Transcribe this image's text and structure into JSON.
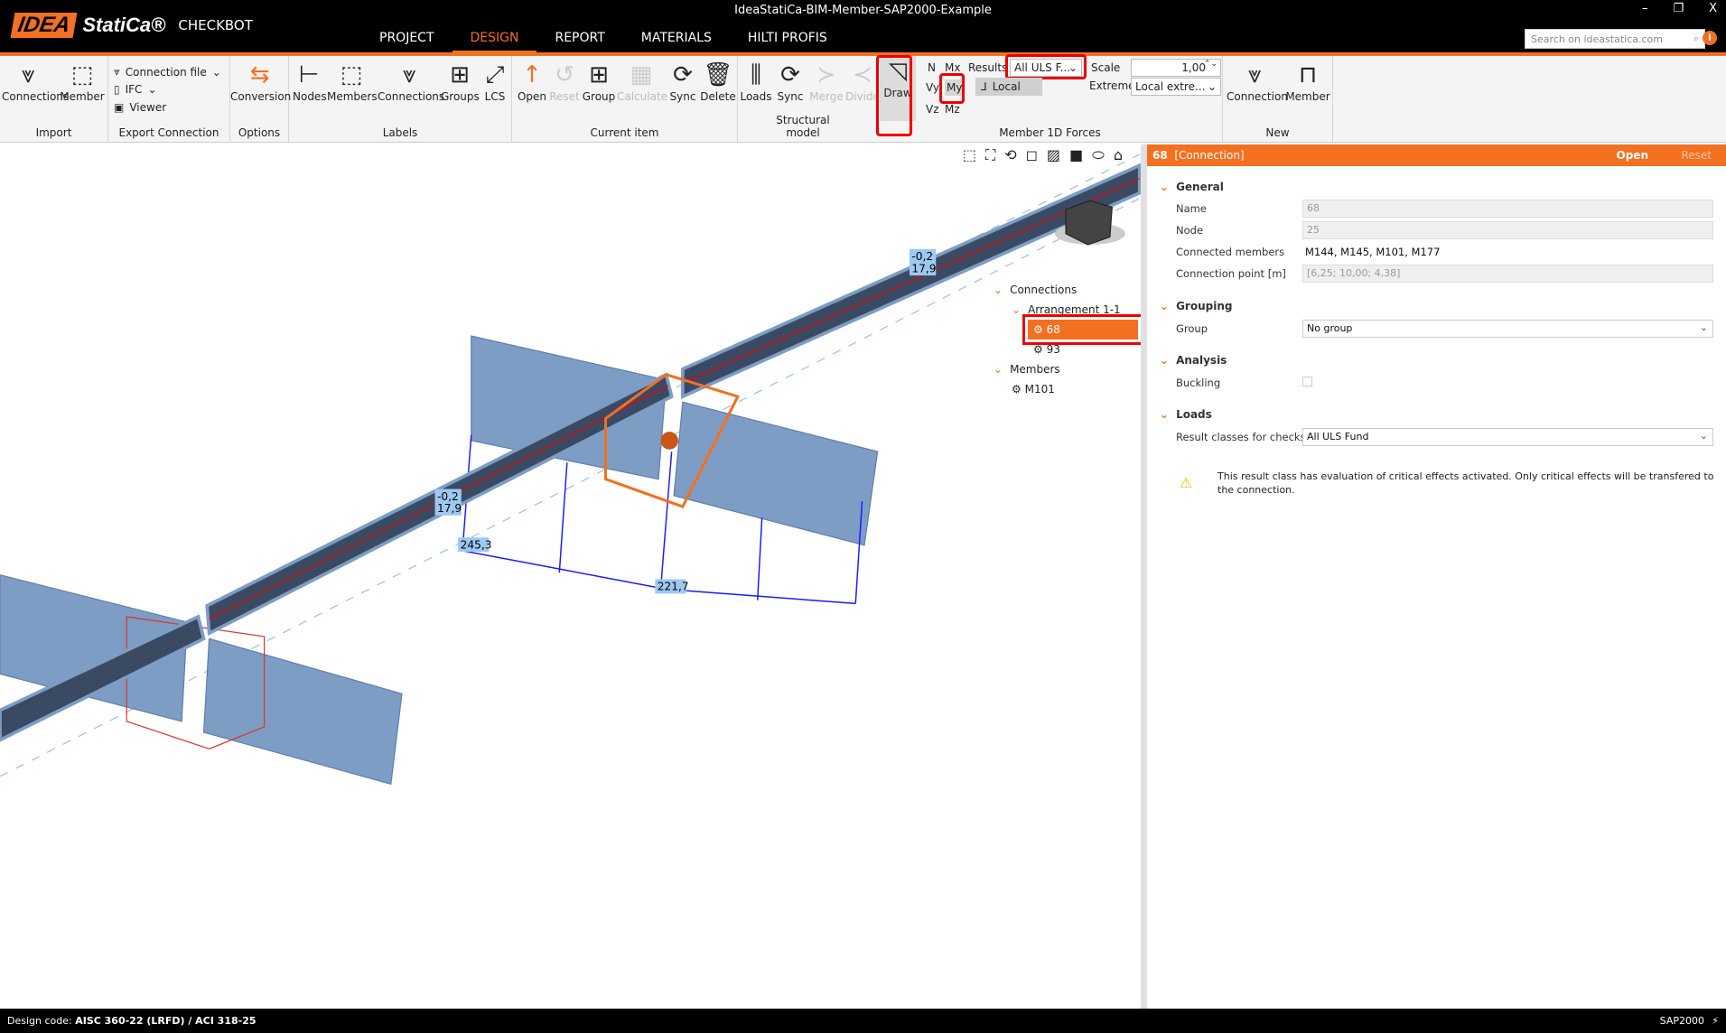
{
  "window": {
    "title": "IdeaStatiCa-BIM-Member-SAP2000-Example",
    "minimize": "–",
    "restore": "❐",
    "close": "X"
  },
  "logo": {
    "idea": "IDEA",
    "statica": "StatiCa®",
    "product": "CHECKBOT"
  },
  "tabs": [
    {
      "label": "PROJECT"
    },
    {
      "label": "DESIGN",
      "active": true
    },
    {
      "label": "REPORT"
    },
    {
      "label": "MATERIALS"
    },
    {
      "label": "HILTI PROFIS"
    }
  ],
  "search": {
    "placeholder": "Search on ideastatica.com"
  },
  "ribbon": {
    "import": {
      "label": "Import",
      "connections": "Connections",
      "member": "Member"
    },
    "export": {
      "label": "Export Connection",
      "connection_file": "Connection file",
      "ifc": "IFC",
      "viewer": "Viewer"
    },
    "options": {
      "label": "Options",
      "conversion": "Conversion"
    },
    "labels": {
      "label": "Labels",
      "nodes": "Nodes",
      "members": "Members",
      "connections": "Connections",
      "groups": "Groups",
      "lcs": "LCS"
    },
    "current": {
      "label": "Current item",
      "open": "Open",
      "reset": "Reset",
      "group": "Group",
      "calculate": "Calculate",
      "sync": "Sync",
      "delete": "Delete"
    },
    "structural": {
      "label": "Structural model",
      "loads": "Loads",
      "sync": "Sync",
      "merge": "Merge",
      "divide": "Divide"
    },
    "forces": {
      "label": "Member 1D Forces",
      "draw": "Draw",
      "n": "N",
      "mx": "Mx",
      "vy": "Vy",
      "my": "My",
      "vz": "Vz",
      "mz": "Mz",
      "results_label": "Results",
      "results_value": "All ULS F...",
      "local": "Local",
      "scale_label": "Scale",
      "scale_value": "1,00",
      "extreme_label": "Extreme",
      "extreme_value": "Local extre..."
    },
    "new": {
      "label": "New",
      "connection": "Connection",
      "member": "Member"
    }
  },
  "viewport": {
    "labels": [
      {
        "text": "-0,2\n17,9"
      },
      {
        "text": "-0,2\n17,9"
      },
      {
        "text": "245,3"
      },
      {
        "text": "221,7"
      }
    ],
    "tree": {
      "connections": "Connections",
      "arrangement": "Arrangement 1-1",
      "items": [
        "68",
        "93"
      ],
      "members": "Members",
      "member_items": [
        "M101"
      ]
    }
  },
  "panel": {
    "id": "68",
    "type": "[Connection]",
    "open": "Open",
    "reset": "Reset",
    "general": "General",
    "name_label": "Name",
    "name": "68",
    "node_label": "Node",
    "node": "25",
    "members_label": "Connected members",
    "members": "M144, M145, M101, M177",
    "point_label": "Connection point [m]",
    "point": "[6,25; 10,00; 4,38]",
    "grouping": "Grouping",
    "group_label": "Group",
    "group": "No group",
    "analysis": "Analysis",
    "buckling_label": "Buckling",
    "buckling": false,
    "loads": "Loads",
    "result_label": "Result classes for checks",
    "result": "All ULS Fund",
    "warning": "This result class has evaluation of critical effects activated. Only critical effects will be transfered to the connection."
  },
  "status": {
    "design_code_label": "Design code:",
    "design_code": "AISC 360-22 (LRFD) / ACI 318-25",
    "app": "SAP2000"
  },
  "colors": {
    "accent": "#f37021",
    "steel": "#7a9cc6",
    "highlight": "#e00000"
  }
}
